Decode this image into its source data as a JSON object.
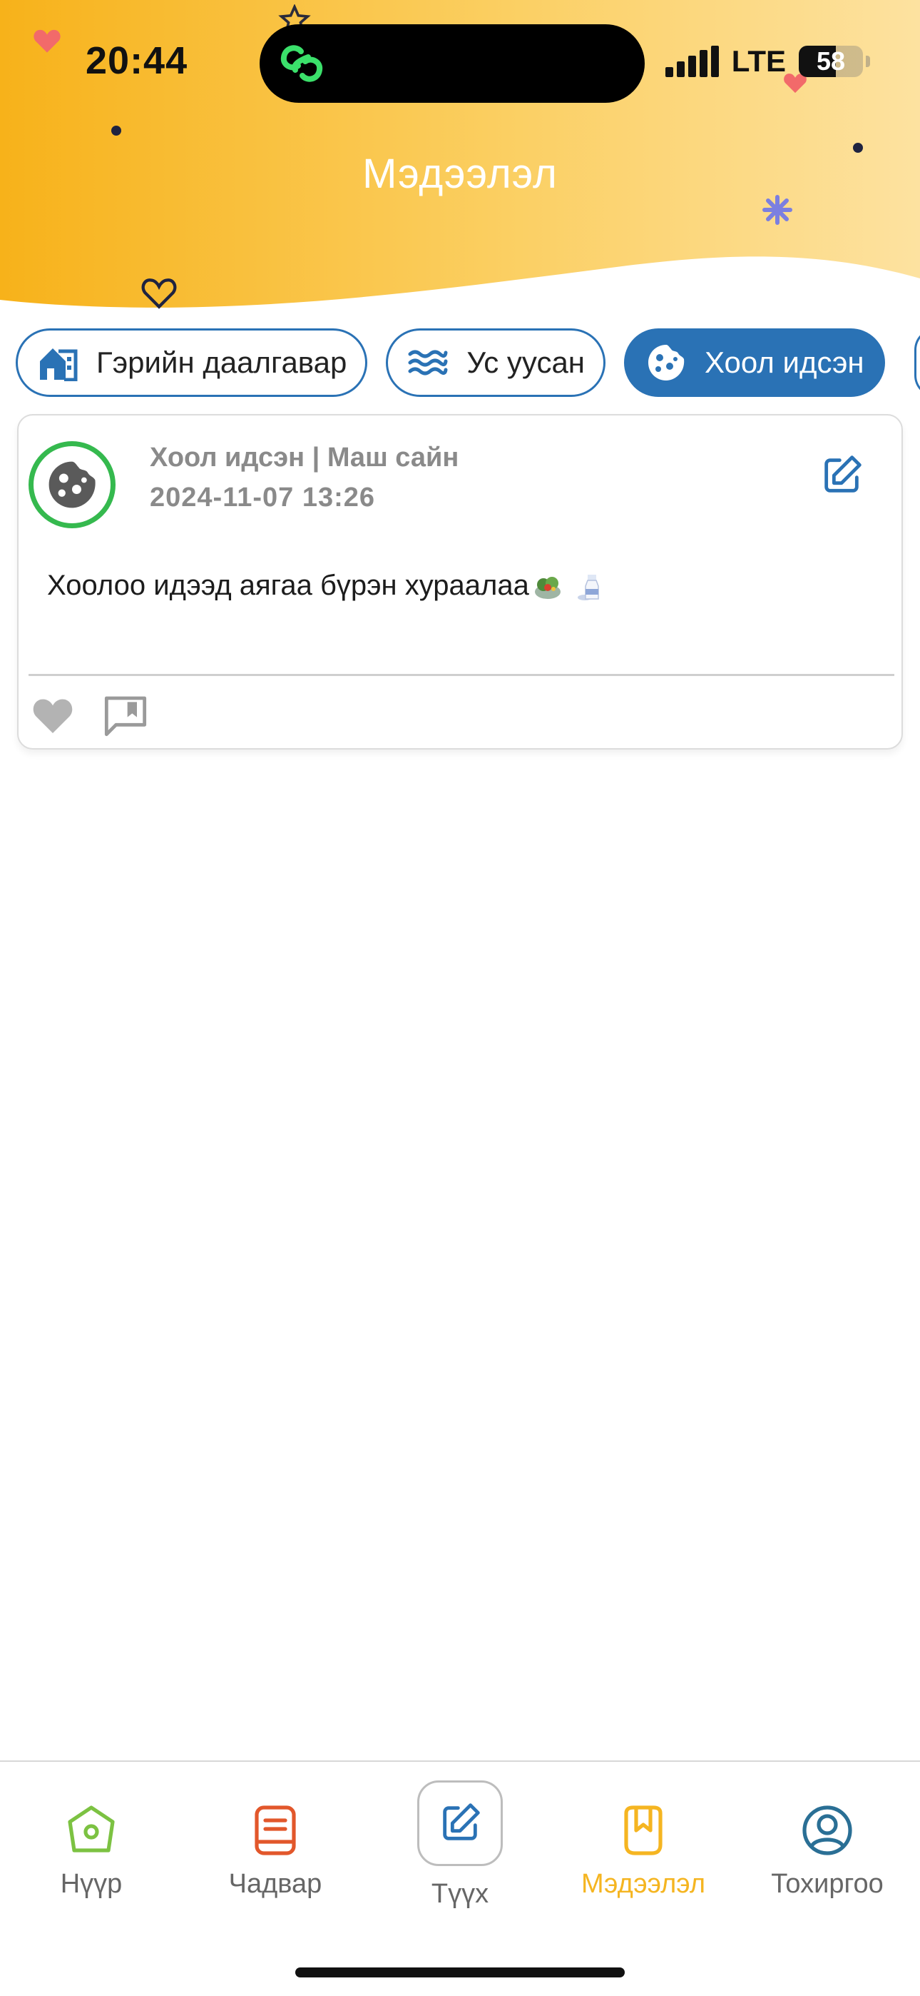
{
  "status_bar": {
    "time": "20:44",
    "network": "LTE",
    "battery": "58",
    "battery_level": 0.58
  },
  "header": {
    "title": "Мэдээлэл",
    "gradient": [
      "#f7b21a",
      "#fbd26a",
      "#fde3a0"
    ]
  },
  "tabs": [
    {
      "label": "Гэрийн даалгавар",
      "icon": "house-icon",
      "active": false
    },
    {
      "label": "Ус уусан",
      "icon": "water-waves-icon",
      "active": false
    },
    {
      "label": "Хоол идсэн",
      "icon": "cookie-icon",
      "active": true
    }
  ],
  "post": {
    "meta_line": "Хоол идсэн | Маш сайн",
    "datetime": "2024-11-07 13:26",
    "body": "Хоолоо идээд аягаа бүрэн хураалаа",
    "body_emojis": [
      "salad-emoji",
      "milk-bottle-emoji"
    ],
    "avatar_ring_color": "#35b94e"
  },
  "bottom_nav": {
    "items": [
      {
        "label": "Нүүр",
        "icon": "home-icon",
        "color": "#7cc242"
      },
      {
        "label": "Чадвар",
        "icon": "book-icon",
        "color": "#e2572b"
      },
      {
        "label": "Түүх",
        "icon": "edit-icon",
        "color": "#2a72b5"
      },
      {
        "label": "Мэдээлэл",
        "icon": "bookmark-book-icon",
        "color": "#f5b521",
        "active": true
      },
      {
        "label": "Тохиргоо",
        "icon": "user-circle-icon",
        "color": "#2a6f95"
      }
    ]
  },
  "colors": {
    "accent_blue": "#2a72b5",
    "active_nav": "#f5b521"
  }
}
